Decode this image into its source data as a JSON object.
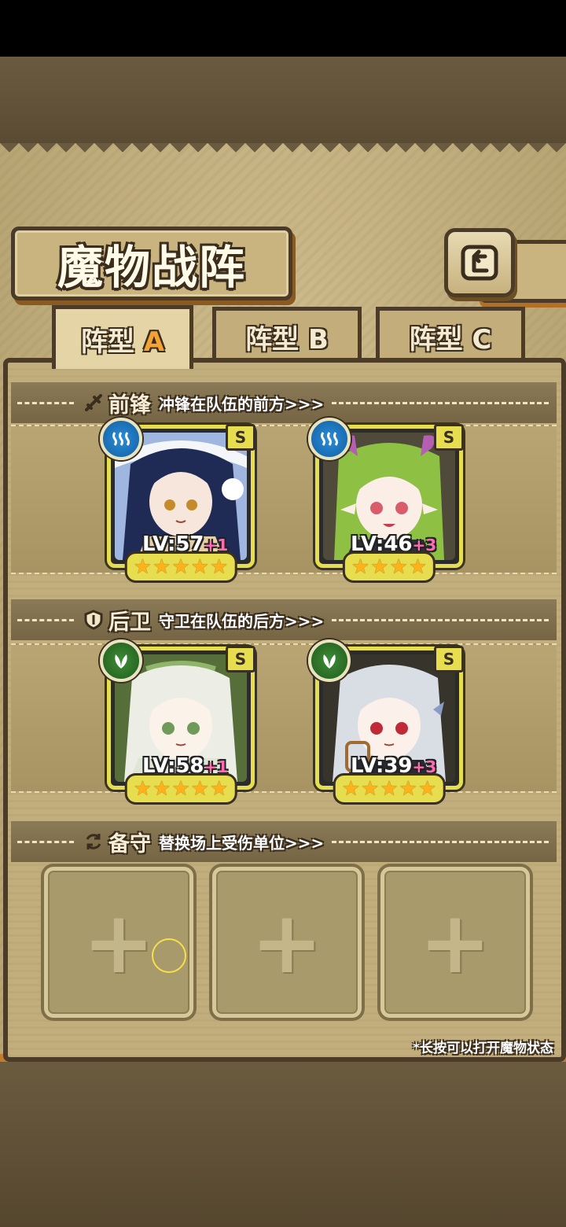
{
  "screen": {
    "title": "魔物战阵",
    "back_label": "返回"
  },
  "tabs": [
    {
      "prefix": "阵型",
      "letter": "A",
      "active": true
    },
    {
      "prefix": "阵型",
      "letter": "B",
      "active": false
    },
    {
      "prefix": "阵型",
      "letter": "C",
      "active": false
    }
  ],
  "sections": {
    "front": {
      "title": "前锋",
      "subtitle": "冲锋在队伍的前方>>>",
      "icon": "sword-icon"
    },
    "back": {
      "title": "后卫",
      "subtitle": "守卫在队伍的后方>>>",
      "icon": "shield-icon"
    },
    "reserve": {
      "title": "备守",
      "subtitle": "替换场上受伤单位>>>",
      "icon": "swap-icon"
    }
  },
  "front_units": [
    {
      "attribute": "water",
      "rank": "S",
      "level": "LV:57",
      "plus": "+1",
      "stars": 5
    },
    {
      "attribute": "water",
      "rank": "S",
      "level": "LV:46",
      "plus": "+3",
      "stars": 4
    }
  ],
  "back_units": [
    {
      "attribute": "wood",
      "rank": "S",
      "level": "LV:58",
      "plus": "+1",
      "stars": 5
    },
    {
      "attribute": "wood",
      "rank": "S",
      "level": "LV:39",
      "plus": "+3",
      "stars": 5
    }
  ],
  "reserve_slots": [
    "+",
    "+",
    "+"
  ],
  "hint": "*长按可以打开魔物状态",
  "colors": {
    "accent": "#f5a234",
    "card_border": "#e7de4f",
    "water": "#1e78c4",
    "wood": "#2f7a2a",
    "plus": "#ff6ab3"
  }
}
